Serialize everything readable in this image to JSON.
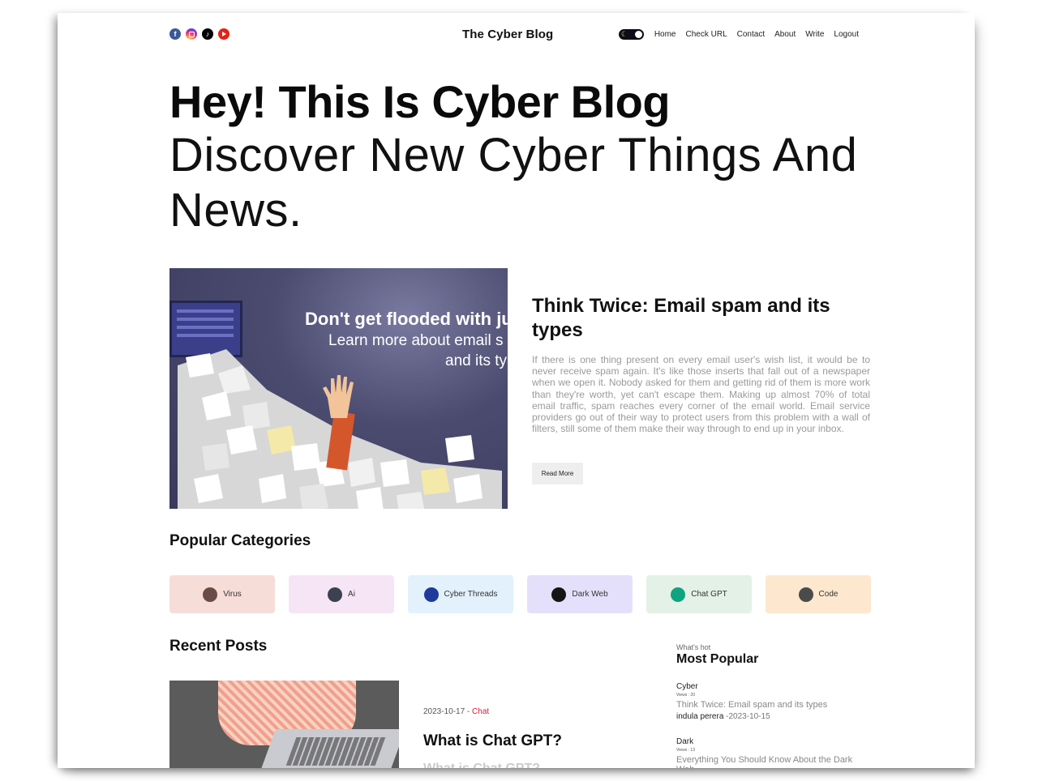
{
  "header": {
    "socials": [
      "facebook-icon",
      "instagram-icon",
      "tiktok-icon",
      "youtube-icon"
    ],
    "logo": "The Cyber Blog",
    "nav": [
      "Home",
      "Check URL",
      "Contact",
      "About",
      "Write",
      "Logout"
    ]
  },
  "hero": {
    "title": "Hey! This Is Cyber Blog",
    "subtitle": "Discover New Cyber Things And News."
  },
  "featured": {
    "image_text_line1": "Don't get flooded with ju",
    "image_text_line2": "Learn more about email s",
    "image_text_line3": "and its ty",
    "title": "Think Twice: Email spam and its types",
    "body": "If there is one thing present on every email user's wish list, it would be to never receive spam again. It's like those inserts that fall out of a newspaper when we open it. Nobody asked for them and getting rid of them is more work than they're worth, yet can't escape them. Making up almost 70% of total email traffic, spam reaches every corner of the email world. Email service providers go out of their way to protect users from this problem with a wall of filters, still some of them make their way through to end up in your inbox.",
    "read_more": "Read More"
  },
  "categories": {
    "title": "Popular Categories",
    "items": [
      {
        "label": "Virus",
        "bg": "#f7ddd8",
        "icon_color": "#6b4b45"
      },
      {
        "label": "Ai",
        "bg": "#f6e5f5",
        "icon_color": "#3c4150"
      },
      {
        "label": "Cyber Threads",
        "bg": "#e2f1fb",
        "icon_color": "#1f3a9a"
      },
      {
        "label": "Dark Web",
        "bg": "#e4e0fb",
        "icon_color": "#151515"
      },
      {
        "label": "Chat GPT",
        "bg": "#e3f1e6",
        "icon_color": "#10a37f"
      },
      {
        "label": "Code",
        "bg": "#fde7cf",
        "icon_color": "#4b4b4b"
      }
    ]
  },
  "recent": {
    "title": "Recent Posts",
    "post": {
      "date": "2023-10-17",
      "separator": " - ",
      "category": "Chat",
      "title": "What is Chat GPT?",
      "faded": "What is Chat GPT?"
    }
  },
  "popular": {
    "hot": "What's hot",
    "title": "Most Popular",
    "items": [
      {
        "category": "Cyber",
        "views": "Views : 20",
        "post": "Think Twice: Email spam and its types",
        "author": "indula perera",
        "date": "-2023-10-15"
      },
      {
        "category": "Dark",
        "views": "Views : 13",
        "post": "Everything You Should Know About the Dark Web",
        "author": "",
        "date": ""
      }
    ]
  }
}
